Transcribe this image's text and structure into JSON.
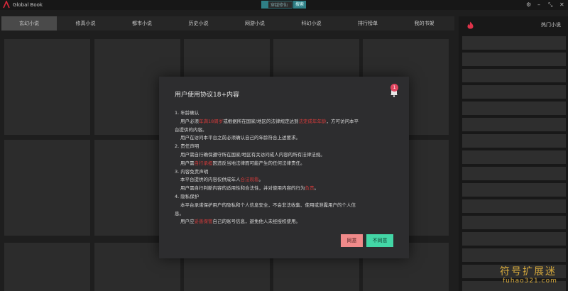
{
  "titlebar": {
    "app_title": "Global Book",
    "search_value": "穿越修仙",
    "search_button": "搜索",
    "settings_glyph": "⚙",
    "minimize_glyph": "–",
    "restore_glyph": "⤡",
    "close_glyph": "✕"
  },
  "tabs": [
    {
      "label": "玄幻小说",
      "active": true
    },
    {
      "label": "修真小说",
      "active": false
    },
    {
      "label": "都市小说",
      "active": false
    },
    {
      "label": "历史小说",
      "active": false
    },
    {
      "label": "网游小说",
      "active": false
    },
    {
      "label": "科幻小说",
      "active": false
    },
    {
      "label": "排行榜单",
      "active": false
    },
    {
      "label": "我的书架",
      "active": false
    }
  ],
  "sidebar": {
    "title": "热门小说",
    "icon": "flame-icon"
  },
  "modal": {
    "title": "用户使用协议18+内容",
    "badge_count": "1",
    "lines": [
      {
        "id": "s1",
        "indent": false,
        "segments": [
          {
            "t": "1. 年龄确认",
            "hl": false
          }
        ]
      },
      {
        "id": "s1a",
        "indent": true,
        "segments": [
          {
            "t": "用户必须",
            "hl": false
          },
          {
            "t": "年满18周岁",
            "hl": true
          },
          {
            "t": "或根据所在国家/地区的法律规定达到",
            "hl": false
          },
          {
            "t": "法定成年年龄",
            "hl": true
          },
          {
            "t": "，方可访问本平",
            "hl": false
          }
        ]
      },
      {
        "id": "s1b",
        "indent": false,
        "segments": [
          {
            "t": "台提供的内容。",
            "hl": false
          }
        ]
      },
      {
        "id": "s1c",
        "indent": true,
        "segments": [
          {
            "t": "用户在访问本平台之前必须确认自己的年龄符合上述要求。",
            "hl": false
          }
        ]
      },
      {
        "id": "s2",
        "indent": false,
        "segments": [
          {
            "t": "2. 责任声明",
            "hl": false
          }
        ]
      },
      {
        "id": "s2a",
        "indent": true,
        "segments": [
          {
            "t": "用户需自行确保遵守所在国家/地区有关访问成人内容的所有法律法规。",
            "hl": false
          }
        ]
      },
      {
        "id": "s2b",
        "indent": true,
        "segments": [
          {
            "t": "用户需",
            "hl": false
          },
          {
            "t": "自行承担",
            "hl": true
          },
          {
            "t": "因违反当地法律而可能产生的任何法律责任。",
            "hl": false
          }
        ]
      },
      {
        "id": "s3",
        "indent": false,
        "segments": [
          {
            "t": "3. 内容免责声明",
            "hl": false
          }
        ]
      },
      {
        "id": "s3a",
        "indent": true,
        "segments": [
          {
            "t": "本平台提供的内容仅供成年人",
            "hl": false
          },
          {
            "t": "合法观看",
            "hl": true
          },
          {
            "t": "。",
            "hl": false
          }
        ]
      },
      {
        "id": "s3b",
        "indent": true,
        "segments": [
          {
            "t": "用户需自行判断内容的适用性和合法性，并对使用内容的行为",
            "hl": false
          },
          {
            "t": "负责",
            "hl": true
          },
          {
            "t": "。",
            "hl": false
          }
        ]
      },
      {
        "id": "s4",
        "indent": false,
        "segments": [
          {
            "t": "4. 隐私保护",
            "hl": false
          }
        ]
      },
      {
        "id": "s4a",
        "indent": true,
        "segments": [
          {
            "t": "本平台承诺保护用户的隐私和个人信息安全，不会非法收集、使用或泄露用户的个人信",
            "hl": false
          }
        ]
      },
      {
        "id": "s4b",
        "indent": false,
        "segments": [
          {
            "t": "息。",
            "hl": false
          }
        ]
      },
      {
        "id": "s4c",
        "indent": true,
        "segments": [
          {
            "t": "用户应",
            "hl": false
          },
          {
            "t": "妥善保管",
            "hl": true
          },
          {
            "t": "自己的账号信息，避免他人未经授权使用。",
            "hl": false
          }
        ]
      }
    ],
    "agree_label": "同意",
    "disagree_label": "不同意"
  },
  "watermark": {
    "text": "符号扩展迷",
    "url": "fuhao321.com"
  },
  "colors": {
    "accent": "#2f7f86",
    "highlight": "#d23a3a",
    "agree": "#f08a8a",
    "disagree": "#43d6a6",
    "watermark": "#d6a93c"
  }
}
